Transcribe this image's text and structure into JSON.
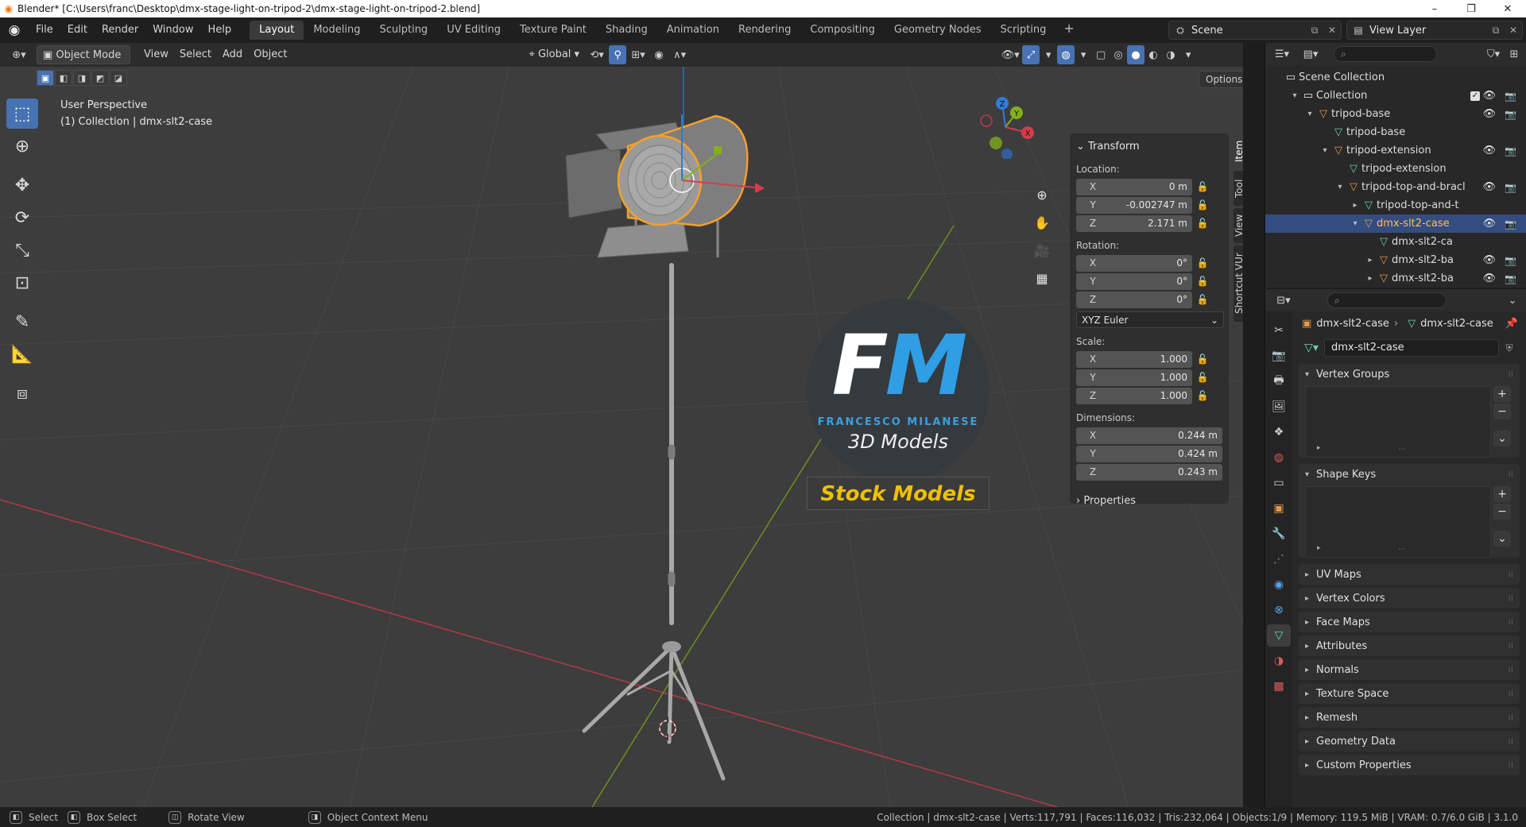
{
  "window": {
    "title": "Blender* [C:\\Users\\franc\\Desktop\\dmx-stage-light-on-tripod-2\\dmx-stage-light-on-tripod-2.blend]",
    "minimize": "–",
    "maximize": "❐",
    "close": "✕"
  },
  "menus": [
    "File",
    "Edit",
    "Render",
    "Window",
    "Help"
  ],
  "workspaces": {
    "active": "Layout",
    "tabs": [
      "Layout",
      "Modeling",
      "Sculpting",
      "UV Editing",
      "Texture Paint",
      "Shading",
      "Animation",
      "Rendering",
      "Compositing",
      "Geometry Nodes",
      "Scripting"
    ],
    "add": "+"
  },
  "scene": {
    "name": "Scene"
  },
  "view_layer": {
    "name": "View Layer"
  },
  "viewport": {
    "mode": "Object Mode",
    "menu": [
      "View",
      "Select",
      "Add",
      "Object"
    ],
    "orientation": "Global",
    "options": "Options",
    "perspective": "User Perspective",
    "context": "(1) Collection | dmx-slt2-case"
  },
  "gizmo": {
    "x": "X",
    "y": "Y",
    "z": "Z"
  },
  "n_panel": {
    "tabs": [
      "Item",
      "Tool",
      "View",
      "Shortcut VUr"
    ],
    "title": "Transform",
    "location_label": "Location:",
    "location": [
      [
        "X",
        "0 m"
      ],
      [
        "Y",
        "-0.002747 m"
      ],
      [
        "Z",
        "2.171 m"
      ]
    ],
    "rotation_label": "Rotation:",
    "rotation": [
      [
        "X",
        "0°"
      ],
      [
        "Y",
        "0°"
      ],
      [
        "Z",
        "0°"
      ]
    ],
    "rotation_mode": "XYZ Euler",
    "scale_label": "Scale:",
    "scale": [
      [
        "X",
        "1.000"
      ],
      [
        "Y",
        "1.000"
      ],
      [
        "Z",
        "1.000"
      ]
    ],
    "dimensions_label": "Dimensions:",
    "dimensions": [
      [
        "X",
        "0.244 m"
      ],
      [
        "Y",
        "0.424 m"
      ],
      [
        "Z",
        "0.243 m"
      ]
    ],
    "properties": "Properties"
  },
  "watermark": {
    "letter_f": "F",
    "letter_m": "M",
    "line1": "FRANCESCO MILANESE",
    "line2": "3D Models",
    "banner": "Stock Models"
  },
  "outliner": {
    "root": "Scene Collection",
    "rows": [
      {
        "name": "Collection",
        "type": "coll",
        "arrow": "▾",
        "indent": 0
      },
      {
        "name": "tripod-base",
        "type": "obj",
        "arrow": "▾",
        "indent": 1
      },
      {
        "name": "tripod-base",
        "type": "mesh",
        "arrow": "",
        "indent": 2
      },
      {
        "name": "tripod-extension",
        "type": "obj",
        "arrow": "▾",
        "indent": 2
      },
      {
        "name": "tripod-extension",
        "type": "mesh",
        "arrow": "",
        "indent": 3
      },
      {
        "name": "tripod-top-and-bracl",
        "type": "obj",
        "arrow": "▾",
        "indent": 3
      },
      {
        "name": "tripod-top-and-t",
        "type": "mesh",
        "arrow": "▸",
        "indent": 4
      },
      {
        "name": "dmx-slt2-case",
        "type": "obj",
        "arrow": "▾",
        "indent": 4,
        "selected": true
      },
      {
        "name": "dmx-slt2-ca",
        "type": "mesh",
        "arrow": "",
        "indent": 5
      },
      {
        "name": "dmx-slt2-ba",
        "type": "obj",
        "arrow": "▸",
        "indent": 5
      },
      {
        "name": "dmx-slt2-ba",
        "type": "obj",
        "arrow": "▸",
        "indent": 5
      }
    ]
  },
  "properties": {
    "breadcrumb_object": "dmx-slt2-case",
    "breadcrumb_data": "dmx-slt2-case",
    "mesh_name": "dmx-slt2-case",
    "panels": [
      "Vertex Groups",
      "Shape Keys",
      "UV Maps",
      "Vertex Colors",
      "Face Maps",
      "Attributes",
      "Normals",
      "Texture Space",
      "Remesh",
      "Geometry Data",
      "Custom Properties"
    ]
  },
  "statusbar": {
    "items": [
      "Select",
      "Box Select",
      "Rotate View",
      "Object Context Menu"
    ],
    "stats": "Collection | dmx-slt2-case | Verts:117,791 | Faces:116,032 | Tris:232,064 | Objects:1/9 | Memory: 119.5 MiB | VRAM: 0.7/6.0 GiB | 3.1.0"
  },
  "colors": {
    "accent": "#4772b3",
    "selection_orange": "#f5a02b",
    "axis_x": "#d63c4a",
    "axis_y": "#82b01a",
    "axis_z": "#2f7dd7"
  }
}
